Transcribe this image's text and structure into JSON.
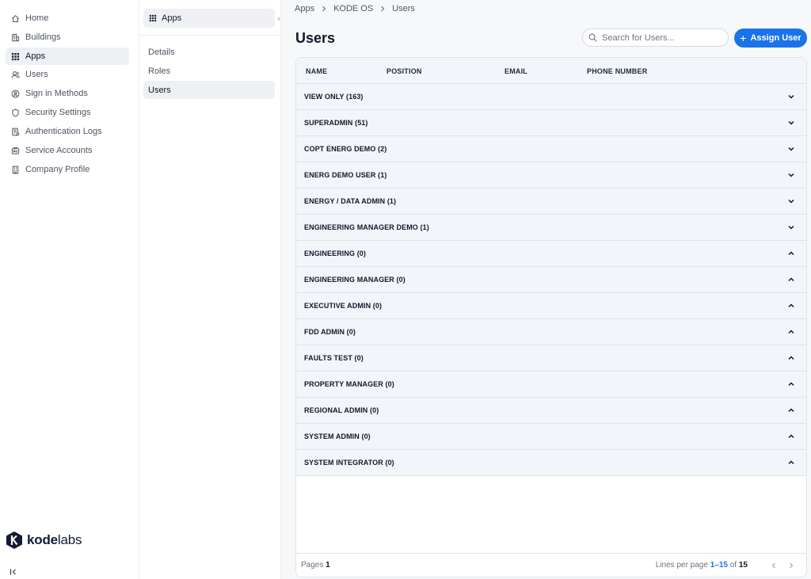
{
  "nav": {
    "items": [
      {
        "label": "Home",
        "icon": "home-icon"
      },
      {
        "label": "Buildings",
        "icon": "building-icon"
      },
      {
        "label": "Apps",
        "icon": "grid-icon",
        "active": true
      },
      {
        "label": "Users",
        "icon": "users-icon"
      },
      {
        "label": "Sign in Methods",
        "icon": "signin-icon"
      },
      {
        "label": "Security Settings",
        "icon": "shield-icon"
      },
      {
        "label": "Authentication Logs",
        "icon": "log-icon"
      },
      {
        "label": "Service Accounts",
        "icon": "service-icon"
      },
      {
        "label": "Company Profile",
        "icon": "company-icon"
      }
    ],
    "logo_bold": "kode",
    "logo_light": "labs"
  },
  "subnav": {
    "header": "Apps",
    "items": [
      {
        "label": "Details"
      },
      {
        "label": "Roles"
      },
      {
        "label": "Users",
        "active": true
      }
    ]
  },
  "breadcrumb": [
    "Apps",
    "KODE OS",
    "Users"
  ],
  "page": {
    "title": "Users",
    "search_placeholder": "Search for Users...",
    "assign_label": "Assign User"
  },
  "table": {
    "columns": [
      "NAME",
      "POSITION",
      "EMAIL",
      "PHONE NUMBER"
    ],
    "rows": [
      {
        "label": "VIEW ONLY (163)",
        "chevron": "down"
      },
      {
        "label": "SUPERADMIN (51)",
        "chevron": "down"
      },
      {
        "label": "COPT ENERG DEMO (2)",
        "chevron": "down"
      },
      {
        "label": "ENERG DEMO USER (1)",
        "chevron": "down"
      },
      {
        "label": "ENERGY / DATA ADMIN (1)",
        "chevron": "down"
      },
      {
        "label": "ENGINEERING MANAGER DEMO (1)",
        "chevron": "down"
      },
      {
        "label": "ENGINEERING (0)",
        "chevron": "up"
      },
      {
        "label": "ENGINEERING MANAGER (0)",
        "chevron": "up"
      },
      {
        "label": "EXECUTIVE ADMIN (0)",
        "chevron": "up"
      },
      {
        "label": "FDD ADMIN (0)",
        "chevron": "up"
      },
      {
        "label": "FAULTS TEST (0)",
        "chevron": "up"
      },
      {
        "label": "PROPERTY MANAGER (0)",
        "chevron": "up"
      },
      {
        "label": "REGIONAL ADMIN (0)",
        "chevron": "up"
      },
      {
        "label": "SYSTEM ADMIN (0)",
        "chevron": "up"
      },
      {
        "label": "SYSTEM INTEGRATOR (0)",
        "chevron": "up"
      }
    ]
  },
  "footer": {
    "pages_label": "Pages",
    "pages_value": "1",
    "lines_label": "Lines per page",
    "range": "1–15",
    "of_label": "of",
    "total": "15"
  },
  "colors": {
    "accent": "#1a73e8",
    "row_bg": "#f2f6fb",
    "active_bg": "#eef0f3"
  }
}
